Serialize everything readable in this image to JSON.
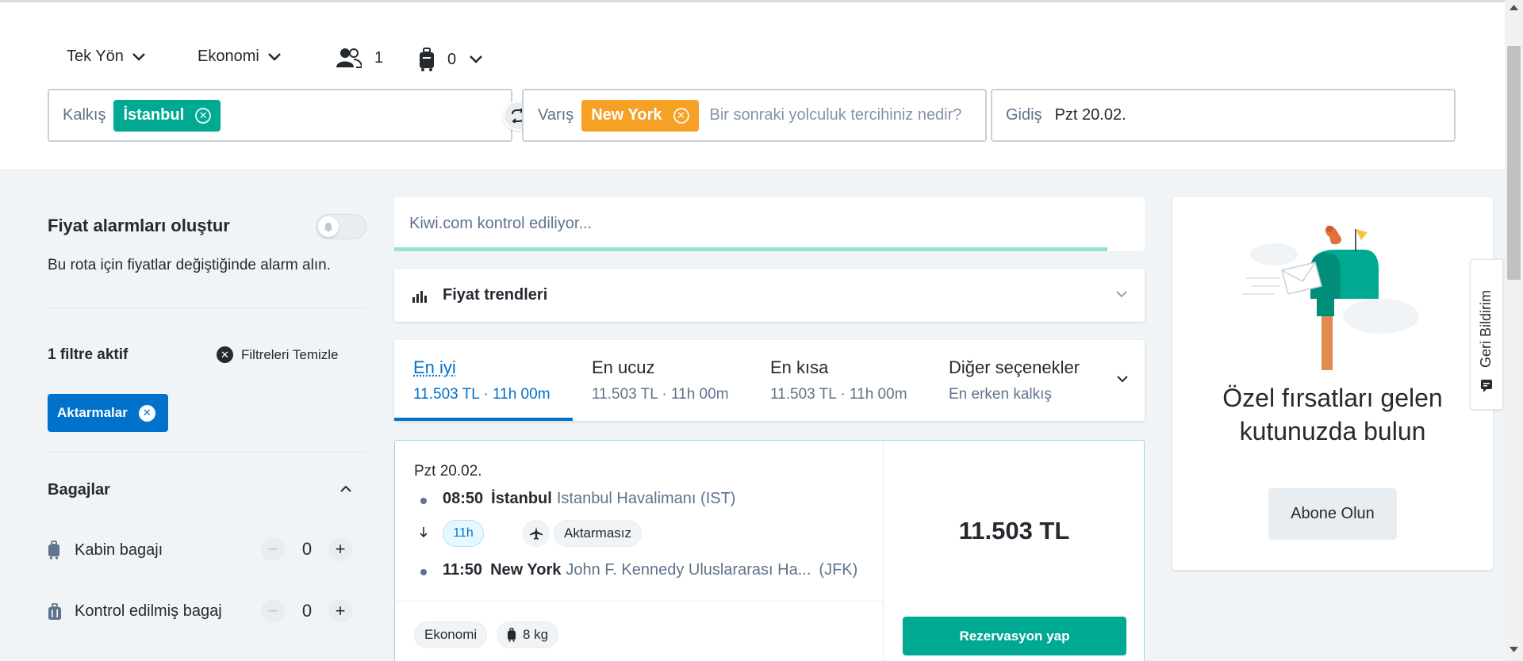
{
  "search": {
    "trip_type": "Tek Yön",
    "cabin_class": "Ekonomi",
    "passengers": "1",
    "bags": "0",
    "origin_label": "Kalkış",
    "origin_chip": "İstanbul",
    "destination_label": "Varış",
    "destination_chip": "New York",
    "destination_placeholder": "Bir sonraki yolculuk tercihiniz nedir?",
    "date_label": "Gidiş",
    "date_value": "Pzt 20.02."
  },
  "sidebar": {
    "alarm_title": "Fiyat alarmları oluştur",
    "alarm_subtitle": "Bu rota için fiyatlar değiştiğinde alarm alın.",
    "filters_active": "1 filtre aktif",
    "clear_filters": "Filtreleri Temizle",
    "active_filter_tag": "Aktarmalar",
    "baggage_title": "Bagajlar",
    "cabin_bag_label": "Kabin bagajı",
    "cabin_bag_count": "0",
    "checked_bag_label": "Kontrol edilmiş bagaj",
    "checked_bag_count": "0"
  },
  "status": {
    "checking_text": "Kiwi.com kontrol ediliyor...",
    "progress_fraction": 0.95
  },
  "price_trends": {
    "label": "Fiyat trendleri"
  },
  "sort_tabs": [
    {
      "title": "En iyi",
      "subtitle": "11.503 TL · 11h 00m",
      "active": true
    },
    {
      "title": "En ucuz",
      "subtitle": "11.503 TL · 11h 00m",
      "active": false
    },
    {
      "title": "En kısa",
      "subtitle": "11.503 TL · 11h 00m",
      "active": false
    },
    {
      "title": "Diğer seçenekler",
      "subtitle": "En erken kalkış",
      "active": false
    }
  ],
  "result": {
    "date": "Pzt 20.02.",
    "departure_time": "08:50",
    "departure_city": "İstanbul",
    "departure_airport": "Istanbul Havalimanı (IST)",
    "duration": "11h",
    "stops": "Aktarmasız",
    "arrival_time": "11:50",
    "arrival_city": "New York",
    "arrival_airport": "John F. Kennedy Uluslararası Ha...",
    "arrival_code": "(JFK)",
    "fare_class": "Ekonomi",
    "cabin_bag_weight": "8 kg",
    "price": "11.503 TL",
    "book_label": "Rezervasyon yap"
  },
  "promo": {
    "title": "Özel fırsatları gelen kutunuzda bulun",
    "button": "Abone Olun"
  },
  "feedback": {
    "label": "Geri Bildirim"
  },
  "colors": {
    "accent_blue": "#0172cb",
    "origin_chip": "#00a991",
    "destination_chip": "#f6a025",
    "book_button": "#00a991"
  }
}
